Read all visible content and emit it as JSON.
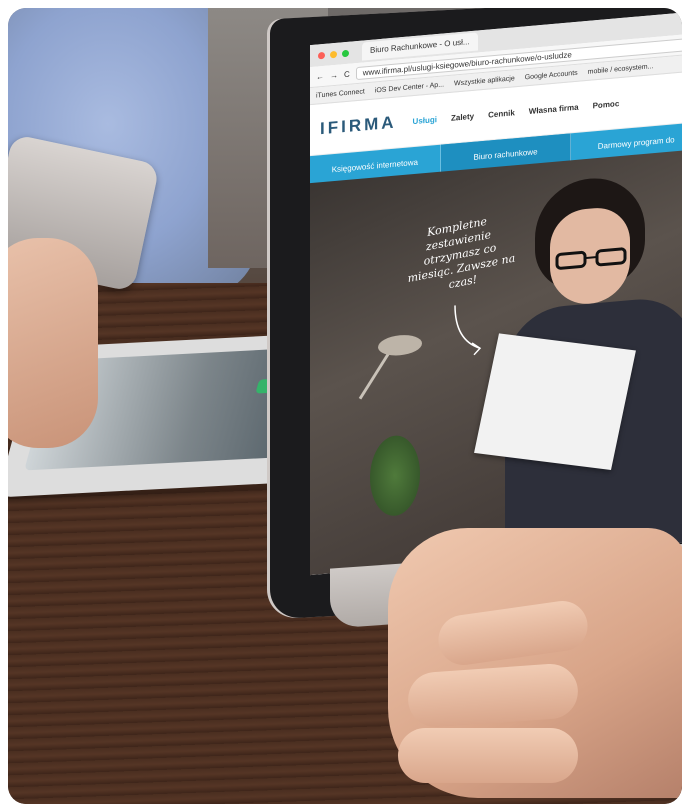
{
  "browser": {
    "tab_title": "Biuro Rachunkowe - O usł...",
    "url": "www.ifirma.pl/uslugi-ksiegowe/biuro-rachunkowe/o-usludze",
    "bookmarks": [
      "iTunes Connect",
      "iOS Dev Center - Ap...",
      "Wszystkie aplikacje",
      "Google Accounts",
      "mobile / ecosystem..."
    ]
  },
  "site": {
    "logo": "IFIRMA",
    "nav": [
      "Usługi",
      "Zalety",
      "Cennik",
      "Własna firma",
      "Pomoc"
    ],
    "subnav": [
      "Księgowość internetowa",
      "Biuro rachunkowe",
      "Darmowy program do"
    ],
    "hero_text": "Kompletne zestawienie otrzymasz co miesiąc. Zawsze na czas!"
  },
  "colors": {
    "accent": "#2aa4d5",
    "logo": "#2b5a7a",
    "logo_i": "#f39c12"
  }
}
